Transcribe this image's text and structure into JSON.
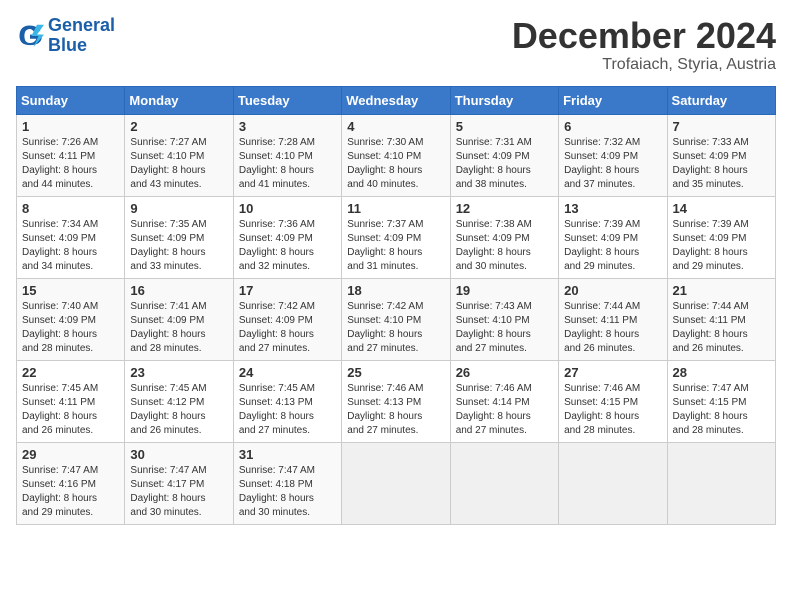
{
  "logo": {
    "line1": "General",
    "line2": "Blue"
  },
  "title": "December 2024",
  "subtitle": "Trofaiach, Styria, Austria",
  "days_of_week": [
    "Sunday",
    "Monday",
    "Tuesday",
    "Wednesday",
    "Thursday",
    "Friday",
    "Saturday"
  ],
  "weeks": [
    [
      {
        "day": "1",
        "info": "Sunrise: 7:26 AM\nSunset: 4:11 PM\nDaylight: 8 hours\nand 44 minutes."
      },
      {
        "day": "2",
        "info": "Sunrise: 7:27 AM\nSunset: 4:10 PM\nDaylight: 8 hours\nand 43 minutes."
      },
      {
        "day": "3",
        "info": "Sunrise: 7:28 AM\nSunset: 4:10 PM\nDaylight: 8 hours\nand 41 minutes."
      },
      {
        "day": "4",
        "info": "Sunrise: 7:30 AM\nSunset: 4:10 PM\nDaylight: 8 hours\nand 40 minutes."
      },
      {
        "day": "5",
        "info": "Sunrise: 7:31 AM\nSunset: 4:09 PM\nDaylight: 8 hours\nand 38 minutes."
      },
      {
        "day": "6",
        "info": "Sunrise: 7:32 AM\nSunset: 4:09 PM\nDaylight: 8 hours\nand 37 minutes."
      },
      {
        "day": "7",
        "info": "Sunrise: 7:33 AM\nSunset: 4:09 PM\nDaylight: 8 hours\nand 35 minutes."
      }
    ],
    [
      {
        "day": "8",
        "info": "Sunrise: 7:34 AM\nSunset: 4:09 PM\nDaylight: 8 hours\nand 34 minutes."
      },
      {
        "day": "9",
        "info": "Sunrise: 7:35 AM\nSunset: 4:09 PM\nDaylight: 8 hours\nand 33 minutes."
      },
      {
        "day": "10",
        "info": "Sunrise: 7:36 AM\nSunset: 4:09 PM\nDaylight: 8 hours\nand 32 minutes."
      },
      {
        "day": "11",
        "info": "Sunrise: 7:37 AM\nSunset: 4:09 PM\nDaylight: 8 hours\nand 31 minutes."
      },
      {
        "day": "12",
        "info": "Sunrise: 7:38 AM\nSunset: 4:09 PM\nDaylight: 8 hours\nand 30 minutes."
      },
      {
        "day": "13",
        "info": "Sunrise: 7:39 AM\nSunset: 4:09 PM\nDaylight: 8 hours\nand 29 minutes."
      },
      {
        "day": "14",
        "info": "Sunrise: 7:39 AM\nSunset: 4:09 PM\nDaylight: 8 hours\nand 29 minutes."
      }
    ],
    [
      {
        "day": "15",
        "info": "Sunrise: 7:40 AM\nSunset: 4:09 PM\nDaylight: 8 hours\nand 28 minutes."
      },
      {
        "day": "16",
        "info": "Sunrise: 7:41 AM\nSunset: 4:09 PM\nDaylight: 8 hours\nand 28 minutes."
      },
      {
        "day": "17",
        "info": "Sunrise: 7:42 AM\nSunset: 4:09 PM\nDaylight: 8 hours\nand 27 minutes."
      },
      {
        "day": "18",
        "info": "Sunrise: 7:42 AM\nSunset: 4:10 PM\nDaylight: 8 hours\nand 27 minutes."
      },
      {
        "day": "19",
        "info": "Sunrise: 7:43 AM\nSunset: 4:10 PM\nDaylight: 8 hours\nand 27 minutes."
      },
      {
        "day": "20",
        "info": "Sunrise: 7:44 AM\nSunset: 4:11 PM\nDaylight: 8 hours\nand 26 minutes."
      },
      {
        "day": "21",
        "info": "Sunrise: 7:44 AM\nSunset: 4:11 PM\nDaylight: 8 hours\nand 26 minutes."
      }
    ],
    [
      {
        "day": "22",
        "info": "Sunrise: 7:45 AM\nSunset: 4:11 PM\nDaylight: 8 hours\nand 26 minutes."
      },
      {
        "day": "23",
        "info": "Sunrise: 7:45 AM\nSunset: 4:12 PM\nDaylight: 8 hours\nand 26 minutes."
      },
      {
        "day": "24",
        "info": "Sunrise: 7:45 AM\nSunset: 4:13 PM\nDaylight: 8 hours\nand 27 minutes."
      },
      {
        "day": "25",
        "info": "Sunrise: 7:46 AM\nSunset: 4:13 PM\nDaylight: 8 hours\nand 27 minutes."
      },
      {
        "day": "26",
        "info": "Sunrise: 7:46 AM\nSunset: 4:14 PM\nDaylight: 8 hours\nand 27 minutes."
      },
      {
        "day": "27",
        "info": "Sunrise: 7:46 AM\nSunset: 4:15 PM\nDaylight: 8 hours\nand 28 minutes."
      },
      {
        "day": "28",
        "info": "Sunrise: 7:47 AM\nSunset: 4:15 PM\nDaylight: 8 hours\nand 28 minutes."
      }
    ],
    [
      {
        "day": "29",
        "info": "Sunrise: 7:47 AM\nSunset: 4:16 PM\nDaylight: 8 hours\nand 29 minutes."
      },
      {
        "day": "30",
        "info": "Sunrise: 7:47 AM\nSunset: 4:17 PM\nDaylight: 8 hours\nand 30 minutes."
      },
      {
        "day": "31",
        "info": "Sunrise: 7:47 AM\nSunset: 4:18 PM\nDaylight: 8 hours\nand 30 minutes."
      },
      null,
      null,
      null,
      null
    ]
  ]
}
